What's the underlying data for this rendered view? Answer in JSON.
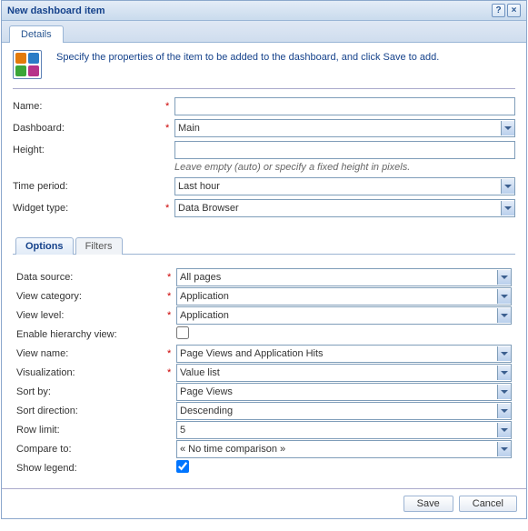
{
  "title": "New dashboard item",
  "tabs": {
    "details": "Details"
  },
  "summary": "Specify the properties of the item to be added to the dashboard, and click Save to add.",
  "top_form": {
    "name_label": "Name:",
    "name_value": "",
    "dashboard_label": "Dashboard:",
    "dashboard_value": "Main",
    "height_label": "Height:",
    "height_value": "",
    "height_hint": "Leave empty (auto) or specify a fixed height in pixels.",
    "time_period_label": "Time period:",
    "time_period_value": "Last hour",
    "widget_type_label": "Widget type:",
    "widget_type_value": "Data Browser"
  },
  "subtabs": {
    "options": "Options",
    "filters": "Filters"
  },
  "options_form": {
    "data_source_label": "Data source:",
    "data_source_value": "All pages",
    "view_category_label": "View category:",
    "view_category_value": "Application",
    "view_level_label": "View level:",
    "view_level_value": "Application",
    "enable_hierarchy_label": "Enable hierarchy view:",
    "enable_hierarchy_checked": false,
    "view_name_label": "View name:",
    "view_name_value": "Page Views and Application Hits",
    "visualization_label": "Visualization:",
    "visualization_value": "Value list",
    "sort_by_label": "Sort by:",
    "sort_by_value": "Page Views",
    "sort_direction_label": "Sort direction:",
    "sort_direction_value": "Descending",
    "row_limit_label": "Row limit:",
    "row_limit_value": "5",
    "compare_to_label": "Compare to:",
    "compare_to_value": "« No time comparison »",
    "show_legend_label": "Show legend:",
    "show_legend_checked": true
  },
  "buttons": {
    "save": "Save",
    "cancel": "Cancel"
  }
}
